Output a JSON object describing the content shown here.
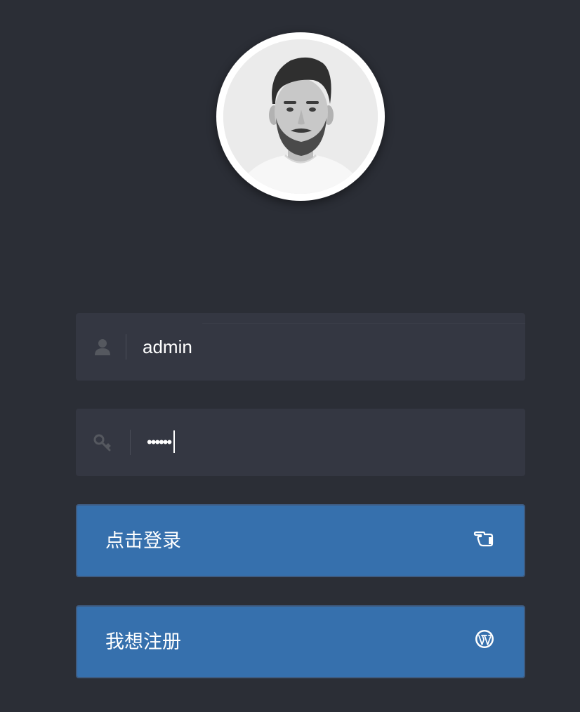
{
  "profile": {
    "avatar_icon": "user-portrait"
  },
  "form": {
    "username": {
      "icon": "user-icon",
      "value": "admin"
    },
    "password": {
      "icon": "key-icon",
      "masked_value": "••••••"
    }
  },
  "buttons": {
    "login": {
      "label": "点击登录",
      "icon": "pointing-hand-icon"
    },
    "register": {
      "label": "我想注册",
      "icon": "wordpress-icon"
    }
  },
  "colors": {
    "background": "#2b2e36",
    "field_bg": "#343742",
    "button_bg": "#3670ad",
    "text": "#ffffff",
    "icon_muted": "#55585f"
  }
}
